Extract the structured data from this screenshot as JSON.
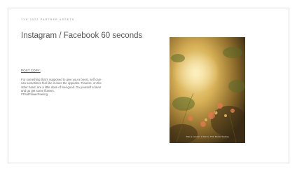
{
  "header": {
    "eyebrow": "TYP 2023 PARTNER ASSETS",
    "title": "Instagram / Facebook 60 seconds"
  },
  "post_copy": {
    "label": "POST COPY:",
    "lines": [
      "For something that's supposed to give you a boost, self care",
      "can sometimes feel like it does the opposite. Flowers, on the",
      "other hand, are a little dose of feel-good. Do yourself a favor",
      "and go get some flowers.",
      "#ThatFlowerFeeling"
    ]
  },
  "media": {
    "caption": "Take a moment to bloom. That Flower Feeling",
    "palette": {
      "glow": "#f3d98a",
      "gold": "#c99a3a",
      "shadow": "#3a2c14",
      "petal": "#e07a4a"
    }
  }
}
